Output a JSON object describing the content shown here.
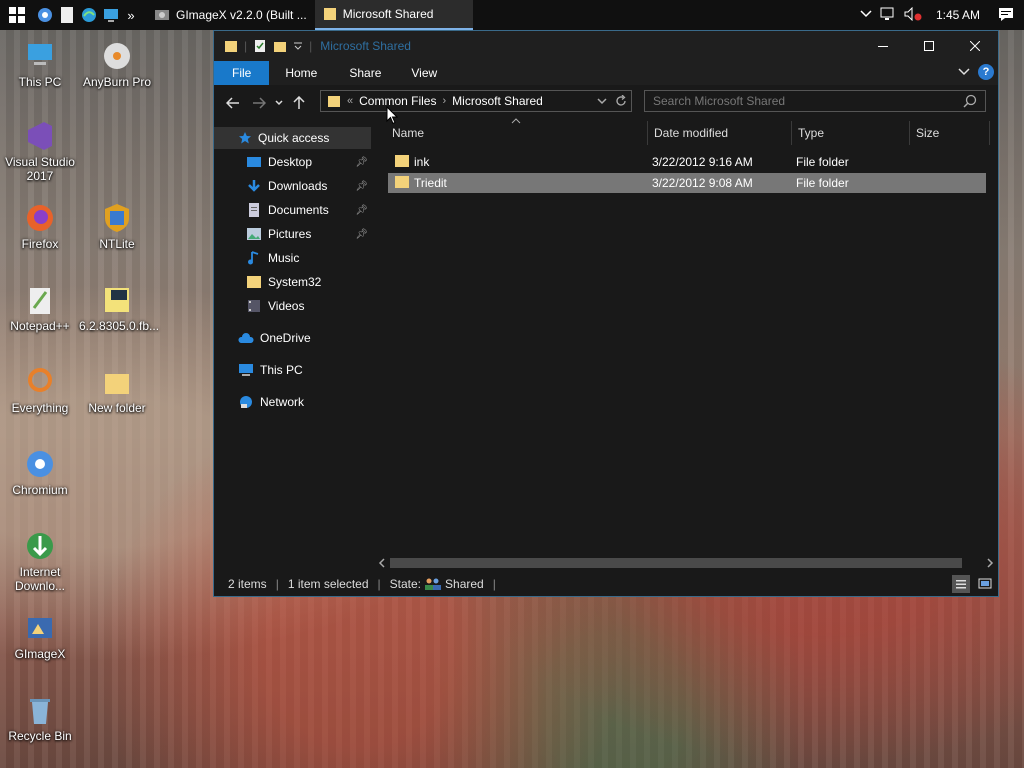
{
  "taskbar": {
    "apps": [
      {
        "label": "GImageX v2.2.0 (Built ..."
      },
      {
        "label": "Microsoft Shared"
      }
    ],
    "overflow": "»",
    "clock": "1:45 AM"
  },
  "desktop": {
    "icons": [
      {
        "label": "This PC"
      },
      {
        "label": "AnyBurn Pro"
      },
      {
        "label": "Visual Studio 2017"
      },
      {
        "label": "Firefox"
      },
      {
        "label": "NTLite"
      },
      {
        "label": "Notepad++"
      },
      {
        "label": "6.2.8305.0.fb..."
      },
      {
        "label": "Everything"
      },
      {
        "label": "New folder"
      },
      {
        "label": "Chromium"
      },
      {
        "label": "Internet Downlo..."
      },
      {
        "label": "GImageX"
      },
      {
        "label": "Recycle Bin"
      }
    ]
  },
  "window": {
    "title": "Microsoft Shared",
    "ribbon_tabs": [
      {
        "label": "File"
      },
      {
        "label": "Home"
      },
      {
        "label": "Share"
      },
      {
        "label": "View"
      }
    ],
    "address": {
      "overflow": "«",
      "segments": [
        {
          "label": "Common Files"
        },
        {
          "label": "Microsoft Shared"
        }
      ]
    },
    "search_placeholder": "Search Microsoft Shared",
    "nav": {
      "quick_access": "Quick access",
      "items": [
        {
          "label": "Desktop"
        },
        {
          "label": "Downloads"
        },
        {
          "label": "Documents"
        },
        {
          "label": "Pictures"
        },
        {
          "label": "Music"
        },
        {
          "label": "System32"
        },
        {
          "label": "Videos"
        }
      ],
      "onedrive": "OneDrive",
      "this_pc": "This PC",
      "network": "Network"
    },
    "columns": {
      "name": "Name",
      "date": "Date modified",
      "type": "Type",
      "size": "Size"
    },
    "files": [
      {
        "name": "ink",
        "date": "3/22/2012 9:16 AM",
        "type": "File folder",
        "selected": false
      },
      {
        "name": "Triedit",
        "date": "3/22/2012 9:08 AM",
        "type": "File folder",
        "selected": true
      }
    ],
    "status": {
      "items": "2 items",
      "selected": "1 item selected",
      "state_label": "State:",
      "state_value": "Shared"
    }
  },
  "colors": {
    "accent": "#1979ca",
    "folder": "#f3d27a",
    "selection": "#777777"
  }
}
